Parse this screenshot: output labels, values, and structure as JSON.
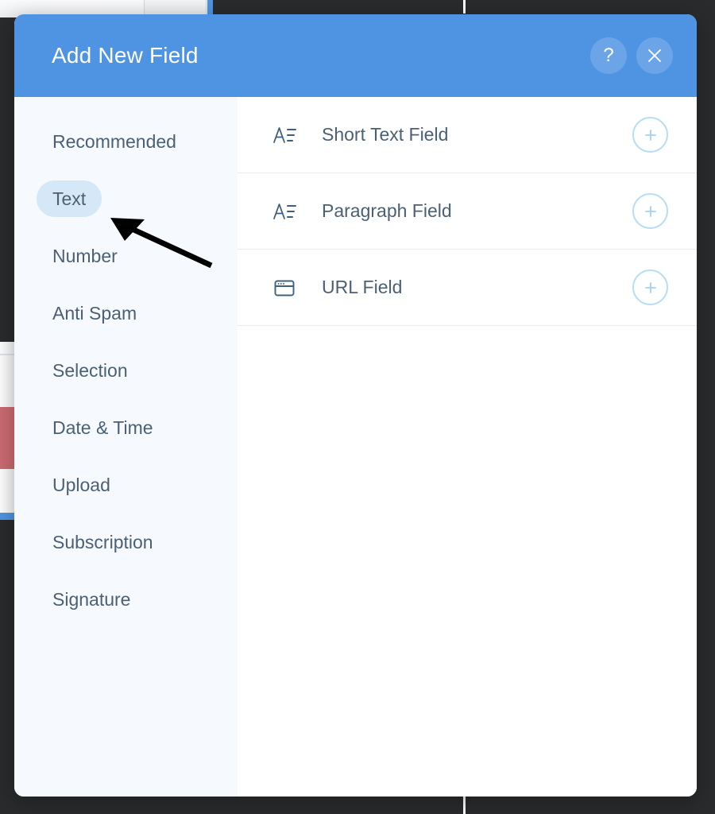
{
  "modal": {
    "title": "Add New Field",
    "help_button": {
      "icon": "question-mark-icon",
      "label": "?"
    },
    "close_button": {
      "icon": "close-x-icon",
      "label": "×"
    }
  },
  "sidebar": {
    "items": [
      {
        "label": "Recommended",
        "active": false
      },
      {
        "label": "Text",
        "active": true
      },
      {
        "label": "Number",
        "active": false
      },
      {
        "label": "Anti Spam",
        "active": false
      },
      {
        "label": "Selection",
        "active": false
      },
      {
        "label": "Date & Time",
        "active": false
      },
      {
        "label": "Upload",
        "active": false
      },
      {
        "label": "Subscription",
        "active": false
      },
      {
        "label": "Signature",
        "active": false
      }
    ]
  },
  "field_list": {
    "rows": [
      {
        "label": "Short Text Field",
        "icon": "text-lines-icon",
        "add_icon": "plus-circle-icon"
      },
      {
        "label": "Paragraph Field",
        "icon": "text-lines-icon",
        "add_icon": "plus-circle-icon"
      },
      {
        "label": "URL Field",
        "icon": "browser-window-icon",
        "add_icon": "plus-circle-icon"
      }
    ]
  },
  "annotation": {
    "type": "arrow",
    "points_to": "Text",
    "color": "#000000"
  },
  "colors": {
    "header_blue": "#4f94e3",
    "sidebar_bg": "#f6f9fd",
    "active_pill": "#d5e8f8",
    "text_slate": "#4c6075",
    "add_button_border": "#b9ddf5",
    "backdrop_dark": "#2a2b2d",
    "accent_red": "#cc6b71"
  }
}
